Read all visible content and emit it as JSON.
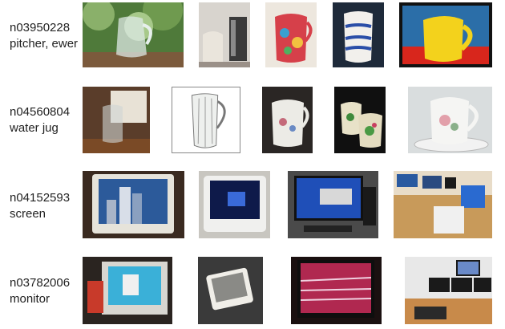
{
  "rows": [
    {
      "wnid": "n03950228",
      "name": "pitcher, ewer"
    },
    {
      "wnid": "n04560804",
      "name": "water jug"
    },
    {
      "wnid": "n04152593",
      "name": "screen"
    },
    {
      "wnid": "n03782006",
      "name": "monitor"
    }
  ]
}
